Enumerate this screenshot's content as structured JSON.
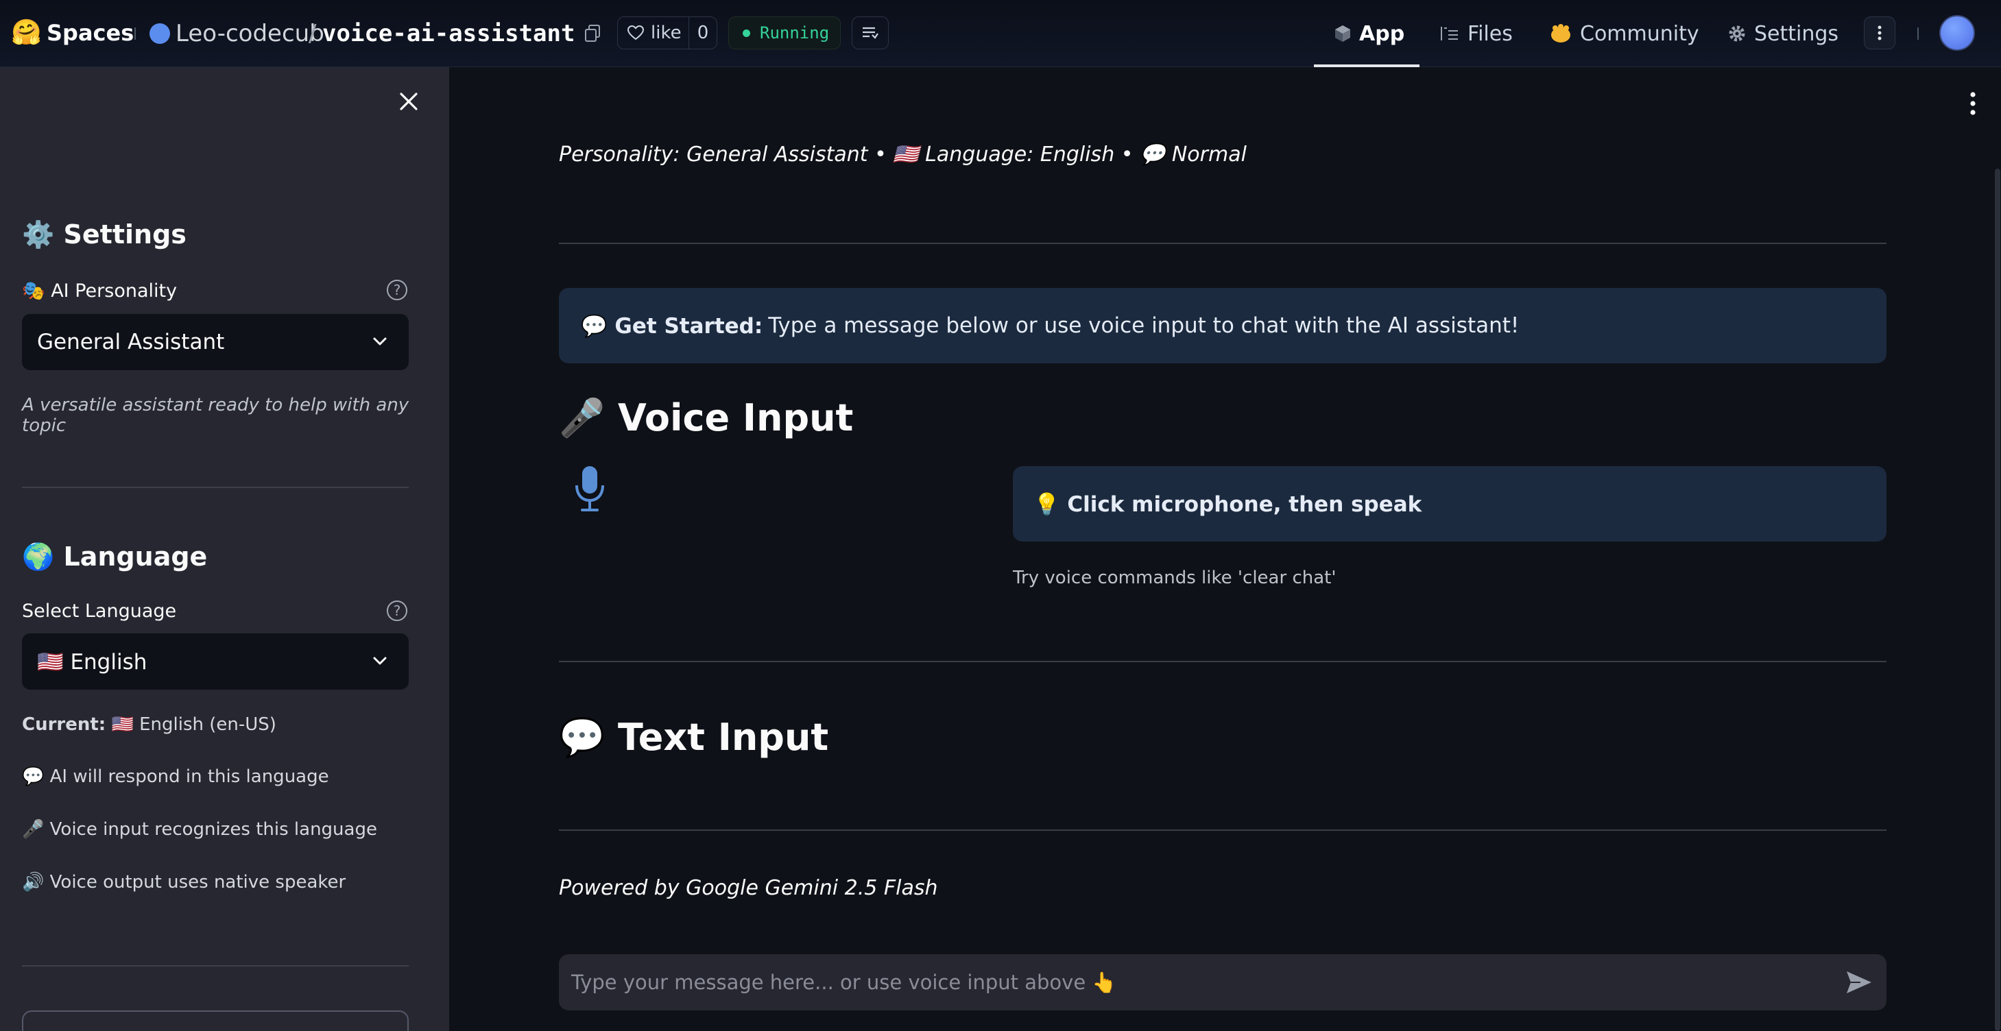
{
  "topbar": {
    "logo_emoji": "🤗",
    "spaces": "Spaces",
    "owner": "Leo-codecub",
    "slash": "/",
    "repo": "voice-ai-assistant",
    "like_label": "like",
    "like_count": "0",
    "status": "Running",
    "tabs": [
      {
        "label": "App",
        "icon": "cube-icon",
        "active": true
      },
      {
        "label": "Files",
        "icon": "files-icon",
        "active": false
      },
      {
        "label": "Community",
        "icon": "community-icon",
        "active": false
      },
      {
        "label": "Settings",
        "icon": "gear-icon",
        "active": false
      }
    ],
    "colors": {
      "running": "#34d399",
      "avatar": "#5b8def"
    }
  },
  "sidebar": {
    "settings_heading": "⚙️ Settings",
    "personality_label": "🎭 AI Personality",
    "personality_value": "General Assistant",
    "personality_caption": "A versatile assistant ready to help with any topic",
    "language_heading": "🌍 Language",
    "language_label": "Select Language",
    "language_value": "🇺🇸 English",
    "current_label": "Current:",
    "current_value": "🇺🇸 English (en-US)",
    "notes": [
      "💬 AI will respond in this language",
      "🎤 Voice input recognizes this language",
      "🔊 Voice output uses native speaker"
    ]
  },
  "main": {
    "status_line": "Personality: General Assistant • 🇺🇸 Language: English • 💬 Normal",
    "get_started_bold": "💬 Get Started:",
    "get_started_text": "Type a message below or use voice input to chat with the AI assistant!",
    "voice_heading": "🎤 Voice Input",
    "tip_text": "💡 Click microphone, then speak",
    "tip_caption": "Try voice commands like 'clear chat'",
    "text_heading": "💬 Text Input",
    "powered_by": "Powered by Google Gemini 2.5 Flash",
    "chat_placeholder": "Type your message here... or use voice input above 👆"
  }
}
